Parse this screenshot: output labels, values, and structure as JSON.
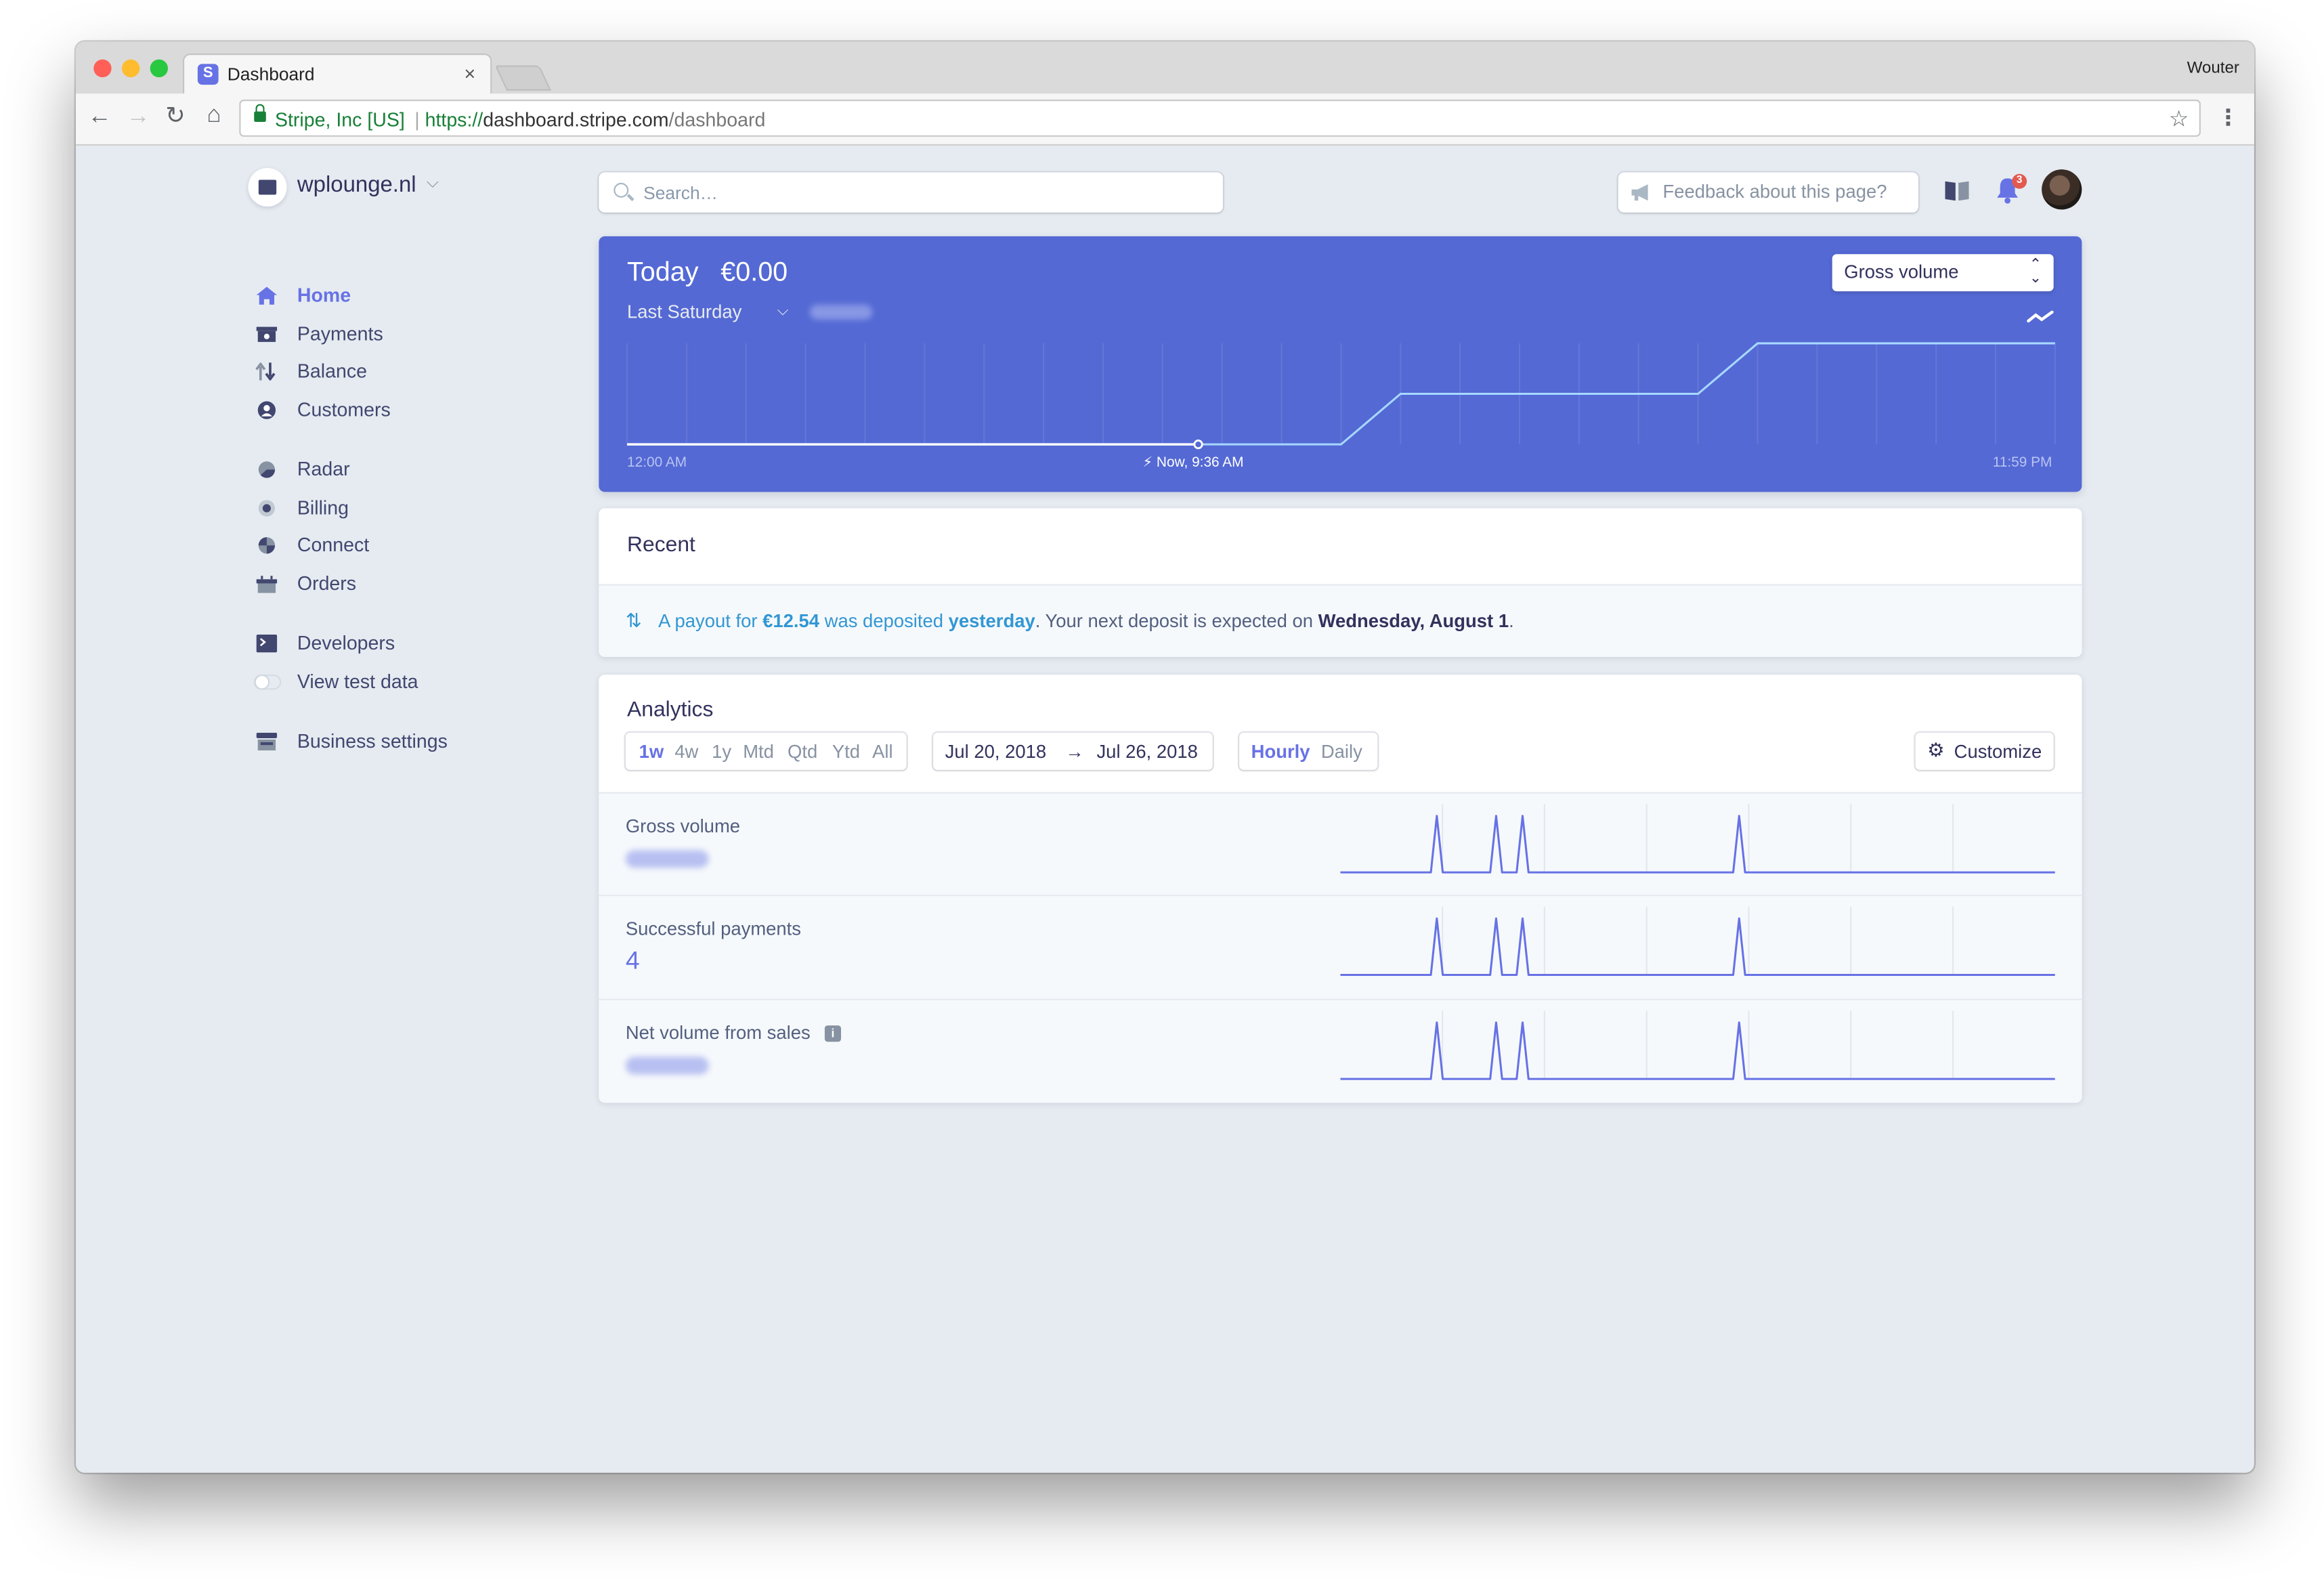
{
  "browser": {
    "tab_title": "Dashboard",
    "tab_favicon": "S",
    "tab_close": "×",
    "user_name": "Wouter",
    "site_identity": "Stripe, Inc [US]",
    "url_scheme": "https://",
    "url_host": "dashboard.stripe.com",
    "url_path": "/dashboard",
    "colors": {
      "close": "#ff5f57",
      "minimize": "#febc2e",
      "maximize": "#28c840"
    }
  },
  "sidebar": {
    "account_name": "wplounge.nl",
    "items": [
      {
        "label": "Home",
        "icon": "home-icon"
      },
      {
        "label": "Payments",
        "icon": "payments-icon"
      },
      {
        "label": "Balance",
        "icon": "balance-icon"
      },
      {
        "label": "Customers",
        "icon": "customers-icon"
      },
      {
        "label": "Radar",
        "icon": "radar-icon"
      },
      {
        "label": "Billing",
        "icon": "billing-icon"
      },
      {
        "label": "Connect",
        "icon": "connect-icon"
      },
      {
        "label": "Orders",
        "icon": "orders-icon"
      },
      {
        "label": "Developers",
        "icon": "terminal-icon"
      },
      {
        "label": "View test data",
        "icon": "toggle-icon"
      },
      {
        "label": "Business settings",
        "icon": "store-icon"
      }
    ],
    "active": "Home"
  },
  "header": {
    "search_placeholder": "Search…",
    "feedback_label": "Feedback about this page?",
    "notification_count": "3"
  },
  "today": {
    "label": "Today",
    "amount": "€0.00",
    "compare_label": "Last Saturday",
    "metric_select": "Gross volume",
    "x_start": "12:00 AM",
    "x_now": "Now, 9:36 AM",
    "x_end": "11:59 PM",
    "colors": {
      "background": "#5469d4",
      "today_line": "#ffffff",
      "last_period_line": "#a7d8ff"
    }
  },
  "chart_data": {
    "type": "line",
    "title": "",
    "xlabel": "",
    "ylabel": "",
    "x_ticks": [
      "12:00 AM",
      "11:59 PM"
    ],
    "x": [
      "0h",
      "1h",
      "2h",
      "3h",
      "4h",
      "5h",
      "6h",
      "7h",
      "8h",
      "9h",
      "10h",
      "11h",
      "12h",
      "13h",
      "14h",
      "15h",
      "16h",
      "17h",
      "18h",
      "19h",
      "20h",
      "21h",
      "22h",
      "23h",
      "24h"
    ],
    "series": [
      {
        "name": "",
        "values": [
          0,
          0,
          0,
          0,
          0,
          0,
          0,
          0,
          0,
          0,
          0,
          0,
          0,
          1,
          1,
          1,
          1,
          1,
          1,
          2,
          2,
          2,
          2,
          2,
          2
        ]
      }
    ],
    "today_until_hour": 9.6,
    "grid": true
  },
  "recent": {
    "title": "Recent",
    "arrows": "⇅",
    "msg_1": "A payout for ",
    "msg_amount": "€12.54",
    "msg_2": " was deposited ",
    "msg_when": "yesterday",
    "msg_3": ". Your next deposit is expected on ",
    "msg_date": "Wednesday, August 1",
    "msg_4": "."
  },
  "analytics": {
    "title": "Analytics",
    "ranges": [
      "1w",
      "4w",
      "1y",
      "Mtd",
      "Qtd",
      "Ytd",
      "All"
    ],
    "active_range": "1w",
    "date_from": "Jul 20, 2018",
    "date_arrow": "→",
    "date_to": "Jul 26, 2018",
    "intervals": [
      "Hourly",
      "Daily"
    ],
    "active_interval": "Hourly",
    "customize_label": "Customize",
    "metrics": [
      {
        "name": "Gross volume",
        "value": ""
      },
      {
        "name": "Successful payments",
        "value": "4"
      },
      {
        "name": "Net volume from sales",
        "value": ""
      }
    ],
    "sparkline_spikes_at": [
      0.135,
      0.218,
      0.255,
      0.558
    ],
    "colors": {
      "sparkline": "#6772e5"
    }
  }
}
